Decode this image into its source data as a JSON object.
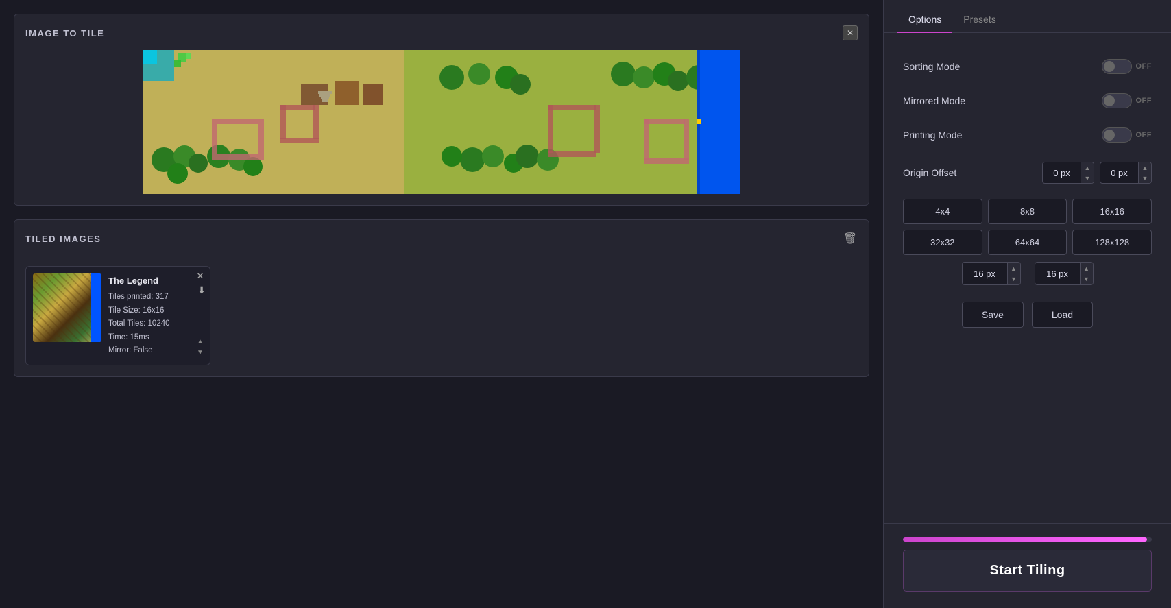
{
  "left": {
    "image_section_title": "IMAGE TO TILE",
    "tiled_section_title": "TILED IMAGES",
    "tiled_card": {
      "title": "The Legend",
      "tiles_printed": "Tiles printed: 317",
      "tile_size": "Tile Size: 16x16",
      "total_tiles": "Total Tiles: 10240",
      "time": "Time: 15ms",
      "mirror": "Mirror: False"
    }
  },
  "right": {
    "tabs": [
      {
        "label": "Options",
        "active": true
      },
      {
        "label": "Presets",
        "active": false
      }
    ],
    "options": {
      "sorting_mode_label": "Sorting Mode",
      "sorting_mode_state": "OFF",
      "mirrored_mode_label": "Mirrored Mode",
      "mirrored_mode_state": "OFF",
      "printing_mode_label": "Printing Mode",
      "printing_mode_state": "OFF",
      "origin_offset_label": "Origin Offset",
      "offset_x_value": "0 px",
      "offset_y_value": "0 px",
      "tile_sizes": [
        "4x4",
        "8x8",
        "16x16",
        "32x32",
        "64x64",
        "128x128"
      ],
      "custom_width_value": "16 px",
      "custom_height_value": "16 px",
      "save_label": "Save",
      "load_label": "Load"
    },
    "start_tiling_label": "Start Tiling",
    "progress_percent": 98
  }
}
